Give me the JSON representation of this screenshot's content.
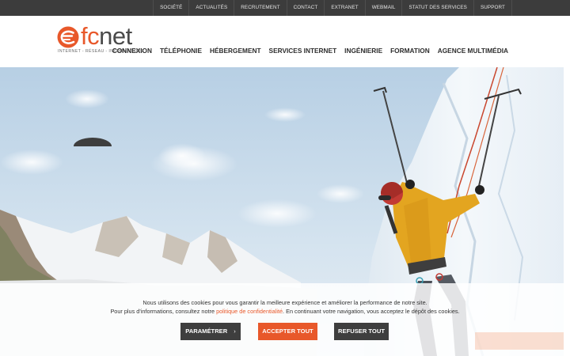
{
  "top_nav": [
    "Société",
    "Actualités",
    "Recrutement",
    "Contact",
    "Extranet",
    "Webmail",
    "Statut des services",
    "Support"
  ],
  "logo": {
    "prefix": "fc",
    "suffix": "net",
    "tagline": "Internet - Réseau - Informatique"
  },
  "main_nav": [
    "Connexion",
    "Téléphonie",
    "Hébergement",
    "Services Internet",
    "Ingénierie",
    "Formation",
    "Agence multimédia"
  ],
  "cookie": {
    "line1": "Nous utilisons des cookies pour vous garantir la meilleure expérience et améliorer la performance de notre site.",
    "line2_before": "Pour plus d'informations, consultez notre ",
    "line2_link": "politique de confidentialité",
    "line2_after": ". En continuant votre navigation, vous acceptez le dépôt des cookies.",
    "settings_label": "Paramétrer",
    "settings_chevron": "›",
    "accept_label": "Accepter tout",
    "refuse_label": "Refuser tout"
  },
  "colors": {
    "brand_orange": "#e8582a",
    "topbar": "#3c3c3c",
    "dark_button": "#3e3e3e"
  },
  "icons": {
    "logo_mark": "fcnet-logo-mark",
    "settings_chevron": "chevron-right-icon"
  }
}
